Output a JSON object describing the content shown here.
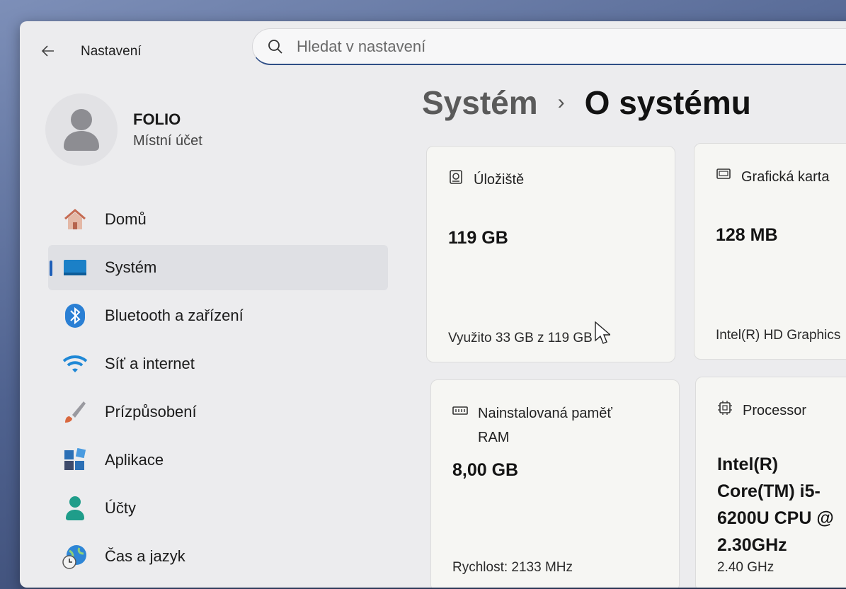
{
  "app": {
    "title": "Nastavení"
  },
  "search": {
    "placeholder": "Hledat v nastavení"
  },
  "profile": {
    "name": "FOLIO",
    "account_type": "Místní účet"
  },
  "nav": {
    "items": [
      {
        "label": "Domů",
        "icon": "home-icon",
        "active": false
      },
      {
        "label": "Systém",
        "icon": "monitor-icon",
        "active": true
      },
      {
        "label": "Bluetooth a zařízení",
        "icon": "bluetooth-icon",
        "active": false
      },
      {
        "label": "Síť a internet",
        "icon": "wifi-icon",
        "active": false
      },
      {
        "label": "Prízpůsobení",
        "icon": "brush-icon",
        "active": false
      },
      {
        "label": "Aplikace",
        "icon": "apps-icon",
        "active": false
      },
      {
        "label": "Účty",
        "icon": "person-icon",
        "active": false
      },
      {
        "label": "Čas a jazyk",
        "icon": "globe-clock-icon",
        "active": false
      }
    ]
  },
  "breadcrumb": {
    "parent": "Systém",
    "separator": "›",
    "current": "O systému"
  },
  "cards": {
    "storage": {
      "title": "Úložiště",
      "value": "119 GB",
      "detail": "Využito 33 GB z 119 GB",
      "icon": "storage-icon"
    },
    "gpu": {
      "title": "Grafická karta",
      "value": "128 MB",
      "detail": "Intel(R) HD Graphics",
      "icon": "gpu-icon"
    },
    "ram": {
      "title": "Nainstalovaná paměť RAM",
      "value": "8,00 GB",
      "detail": "Rychlost: 2133 MHz",
      "icon": "ram-icon"
    },
    "cpu": {
      "title": "Processor",
      "value": "Intel(R) Core(TM) i5-6200U CPU @ 2.30GHz",
      "detail": "2.40 GHz",
      "icon": "cpu-icon"
    }
  },
  "colors": {
    "accent": "#1d5fb8",
    "window_bg": "#ececee",
    "card_bg": "#f6f6f3"
  }
}
